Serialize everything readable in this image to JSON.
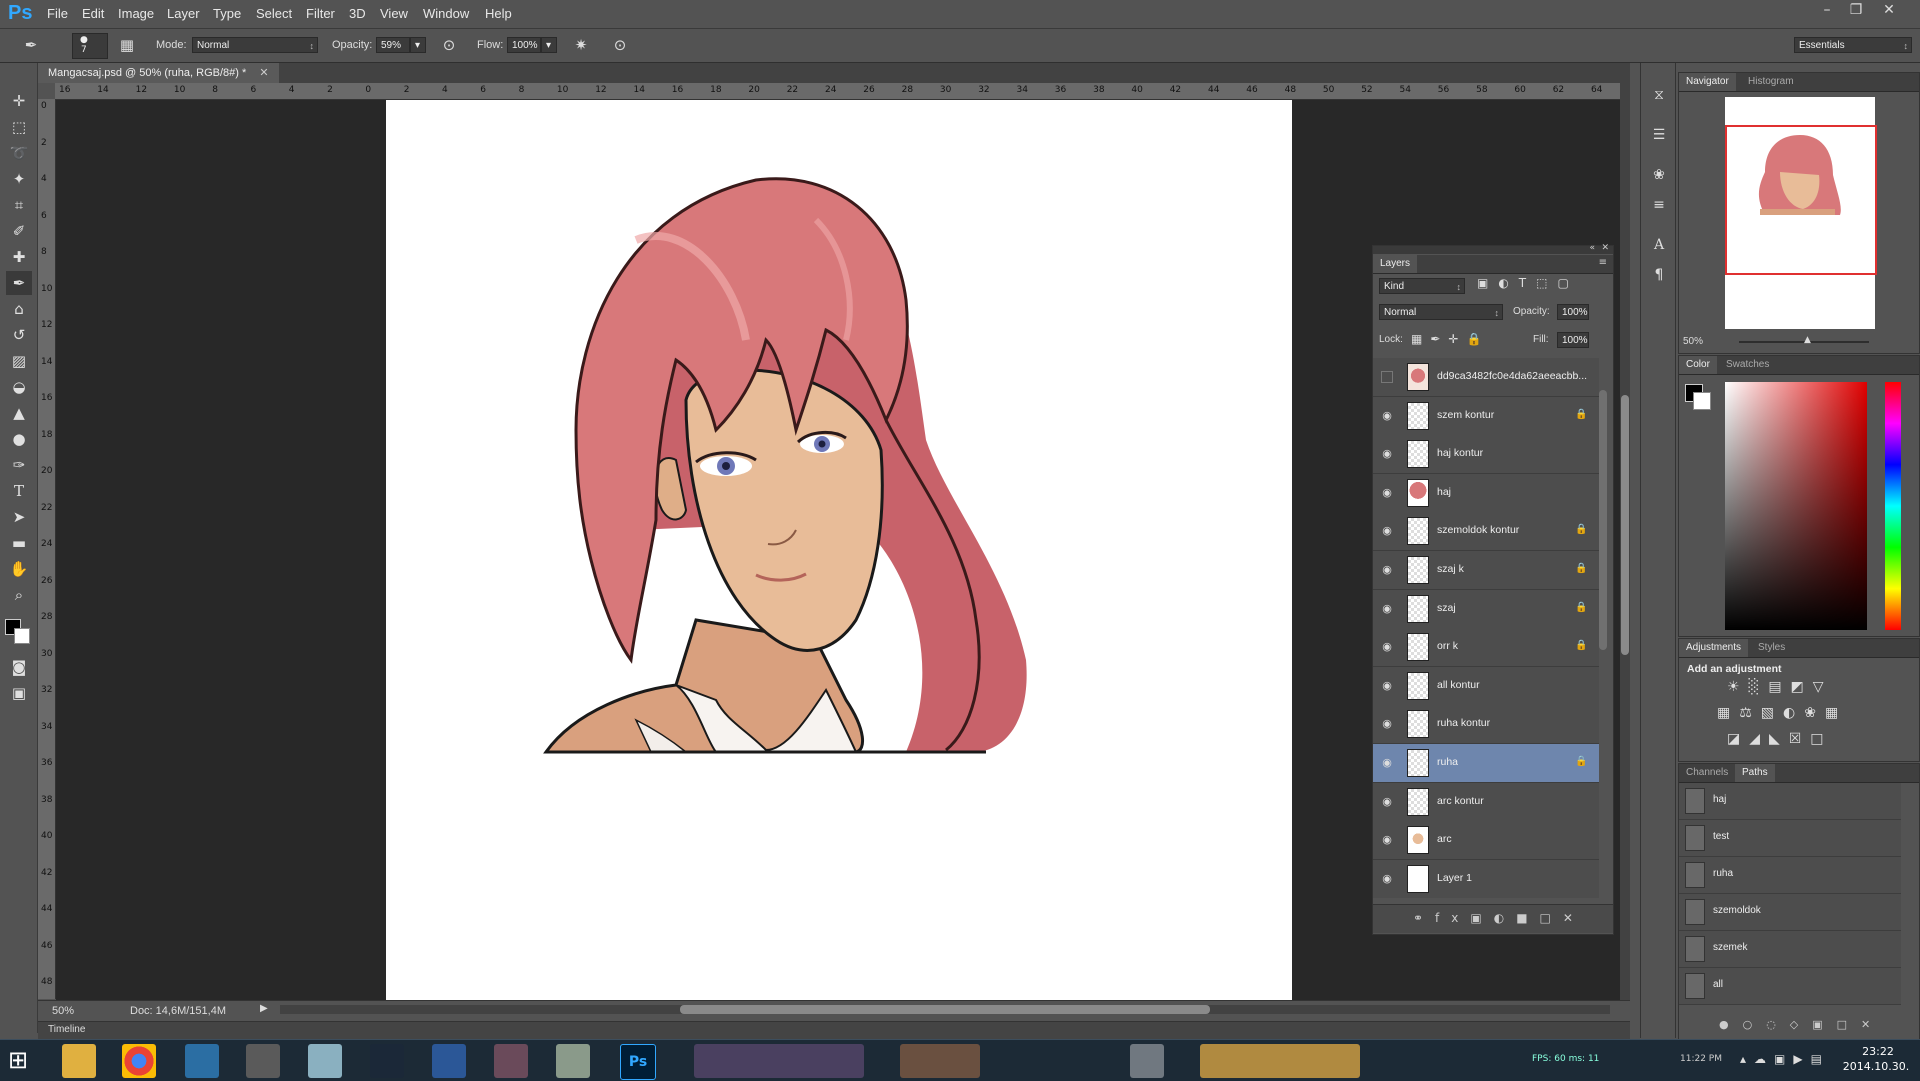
{
  "app": {
    "logo": "Ps"
  },
  "menu": [
    "File",
    "Edit",
    "Image",
    "Layer",
    "Type",
    "Select",
    "Filter",
    "3D",
    "View",
    "Window",
    "Help"
  ],
  "options": {
    "brush_size": "7",
    "mode_label": "Mode:",
    "mode_value": "Normal",
    "opacity_label": "Opacity:",
    "opacity_value": "59%",
    "flow_label": "Flow:",
    "flow_value": "100%",
    "workspace": "Essentials"
  },
  "document": {
    "tab_title": "Mangacsaj.psd @ 50% (ruha, RGB/8#) *",
    "zoom": "50%",
    "doc_size": "Doc: 14,6M/151,4M",
    "timeline_label": "Timeline"
  },
  "rulers": {
    "horizontal": [
      "16",
      "14",
      "12",
      "10",
      "8",
      "6",
      "4",
      "2",
      "0",
      "2",
      "4",
      "6",
      "8",
      "10",
      "12",
      "14",
      "16",
      "18",
      "20",
      "22",
      "24",
      "26",
      "28",
      "30",
      "32",
      "34",
      "36",
      "38",
      "40",
      "42",
      "44",
      "46",
      "48",
      "50",
      "52",
      "54",
      "56",
      "58",
      "60",
      "62",
      "64"
    ],
    "vertical": [
      "0",
      "2",
      "4",
      "6",
      "8",
      "10",
      "12",
      "14",
      "16",
      "18",
      "20",
      "22",
      "24",
      "26",
      "28",
      "30",
      "32",
      "34",
      "36",
      "38",
      "40",
      "42",
      "44",
      "46",
      "48"
    ]
  },
  "navigator": {
    "tabs": [
      "Navigator",
      "Histogram"
    ],
    "zoom": "50%"
  },
  "color_panel": {
    "tabs": [
      "Color",
      "Swatches"
    ]
  },
  "adjustments": {
    "tabs": [
      "Adjustments",
      "Styles"
    ],
    "heading": "Add an adjustment"
  },
  "layers_panel": {
    "title": "Layers",
    "filter": "Kind",
    "blend_mode": "Normal",
    "opacity_label": "Opacity:",
    "opacity": "100%",
    "lock_label": "Lock:",
    "fill_label": "Fill:",
    "fill": "100%",
    "layers": [
      {
        "name": "dd9ca3482fc0e4da62aeeacbb...",
        "visible": false,
        "locked": false,
        "thumb": "image"
      },
      {
        "name": "szem kontur",
        "visible": true,
        "locked": true,
        "thumb": "checker"
      },
      {
        "name": "haj kontur",
        "visible": true,
        "locked": false,
        "thumb": "checker"
      },
      {
        "name": "haj",
        "visible": true,
        "locked": false,
        "thumb": "hair"
      },
      {
        "name": "szemoldok kontur",
        "visible": true,
        "locked": true,
        "thumb": "checker"
      },
      {
        "name": "szaj k",
        "visible": true,
        "locked": true,
        "thumb": "checker"
      },
      {
        "name": "szaj",
        "visible": true,
        "locked": true,
        "thumb": "checker"
      },
      {
        "name": "orr k",
        "visible": true,
        "locked": true,
        "thumb": "checker"
      },
      {
        "name": "all kontur",
        "visible": true,
        "locked": false,
        "thumb": "checker"
      },
      {
        "name": "ruha kontur",
        "visible": true,
        "locked": false,
        "thumb": "checker"
      },
      {
        "name": "ruha",
        "visible": true,
        "locked": true,
        "thumb": "checker",
        "selected": true
      },
      {
        "name": "arc kontur",
        "visible": true,
        "locked": false,
        "thumb": "checker"
      },
      {
        "name": "arc",
        "visible": true,
        "locked": false,
        "thumb": "face"
      },
      {
        "name": "Layer 1",
        "visible": true,
        "locked": false,
        "thumb": "white"
      }
    ]
  },
  "paths_panel": {
    "tabs": [
      "Channels",
      "Paths"
    ],
    "paths": [
      "haj",
      "test",
      "ruha",
      "szemoldok",
      "szemek",
      "all"
    ]
  },
  "taskbar": {
    "fps_label": "FPS:",
    "fps": "60",
    "ms_label": "ms:",
    "ms": "11",
    "clock_small": "11:22 PM",
    "time": "23:22",
    "date": "2014.10.30."
  },
  "colors": {
    "accent_blue": "#31a8ff",
    "selected_layer": "#6e86ad",
    "hair": "#d8787a",
    "skin": "#e8bc98"
  }
}
